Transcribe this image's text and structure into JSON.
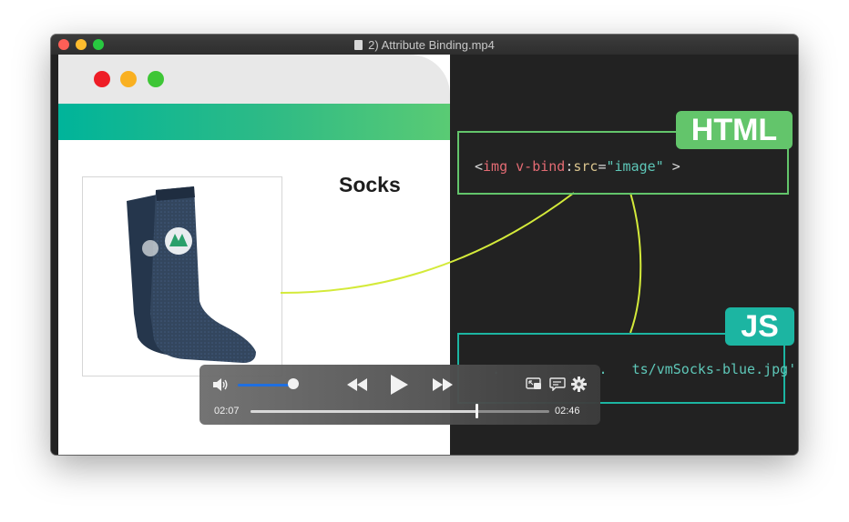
{
  "window": {
    "title": "2) Attribute Binding.mp4"
  },
  "slide": {
    "product_name": "Socks",
    "html_badge": "HTML",
    "js_badge": "JS",
    "html_code": {
      "open": "<",
      "tag": "img",
      "space": " ",
      "attr": "v-bind",
      "colon": ":",
      "attr2": "src",
      "eq": "=",
      "value": "\"image\"",
      "close": " >"
    },
    "js_code_visible": "   .        .   .   ts/vmSocks-blue.jpg'"
  },
  "player": {
    "current_time": "02:07",
    "total_time": "02:46",
    "progress": 0.756,
    "volume": 0.85,
    "icons": [
      "volume-icon",
      "rewind-icon",
      "play-icon",
      "fast-forward-icon",
      "picture-in-picture-icon",
      "subtitles-icon",
      "gear-icon"
    ]
  },
  "colors": {
    "html_green": "#63c56b",
    "js_teal": "#1cb5a2",
    "connector": "#d4ea3a",
    "brand_gradient_start": "#00b49a",
    "brand_gradient_end": "#5acb74"
  }
}
